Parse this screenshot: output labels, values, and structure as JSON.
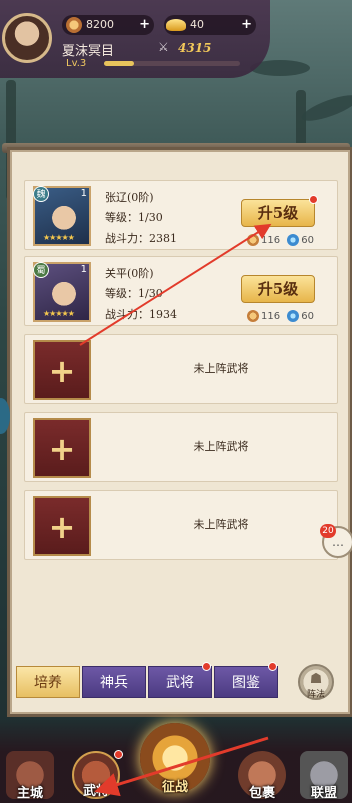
{
  "topbar": {
    "copper": "8200",
    "ingots": "40",
    "player_name": "夏沫冥目",
    "level": "Lv.3",
    "xp_progress": 0.22,
    "combat_power": "4315"
  },
  "heroes": [
    {
      "faction": "魏",
      "count": "1",
      "name": "张辽(0阶)",
      "level": "等级：1/30",
      "power": "战斗力：2381",
      "button": "升5级",
      "cost_copper": "116",
      "cost_exp": "60"
    },
    {
      "faction": "蜀",
      "count": "1",
      "name": "关平(0阶)",
      "level": "等级：1/30",
      "power": "战斗力：1934",
      "button": "升5级",
      "cost_copper": "116",
      "cost_exp": "60"
    }
  ],
  "empty_slots": [
    {
      "plus": "+",
      "label": "未上阵武将"
    },
    {
      "plus": "+",
      "label": "未上阵武将"
    },
    {
      "plus": "+",
      "label": "未上阵武将"
    }
  ],
  "tabs": [
    "培养",
    "神兵",
    "武将",
    "图鉴"
  ],
  "active_tab": "培养",
  "circle_button_label": "阵法",
  "chat_badge": "20",
  "nav": {
    "home": "主城",
    "hero": "武将",
    "battle": "征战",
    "bag": "包裹",
    "union": "联盟"
  },
  "colors": {
    "accent_gold": "#e7b54a",
    "tab_purple": "#5c49a0",
    "annotation_red": "#e23b2b"
  }
}
